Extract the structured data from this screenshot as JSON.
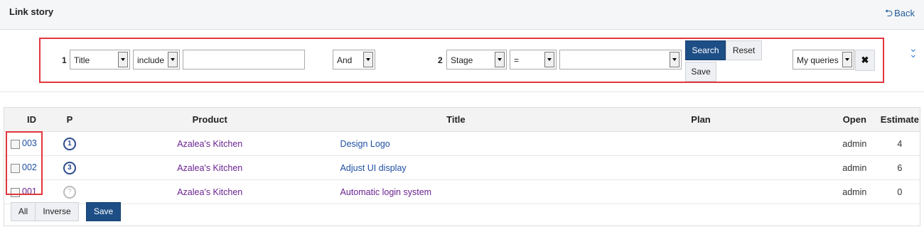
{
  "header": {
    "title": "Link story",
    "back_label": "Back"
  },
  "search": {
    "group1": {
      "index": "1",
      "field": "Title",
      "operator": "include",
      "value": ""
    },
    "logic": "And",
    "group2": {
      "index": "2",
      "field": "Stage",
      "operator": "=",
      "value": ""
    },
    "search_label": "Search",
    "reset_label": "Reset",
    "save_label": "Save",
    "queries_label": "My queries",
    "remove_icon": "✖"
  },
  "table": {
    "headers": [
      "ID",
      "P",
      "Product",
      "Title",
      "Plan",
      "Open",
      "Estimate"
    ],
    "rows": [
      {
        "id": "003",
        "priority": "1",
        "product": "Azalea's Kitchen",
        "title": "Design Logo",
        "plan": "",
        "open": "admin",
        "estimate": "4"
      },
      {
        "id": "002",
        "priority": "3",
        "product": "Azalea's Kitchen",
        "title": "Adjust UI display",
        "plan": "",
        "open": "admin",
        "estimate": "6"
      },
      {
        "id": "001",
        "priority": "?",
        "product": "Azalea's Kitchen",
        "title": "Automatic login system",
        "plan": "",
        "open": "admin",
        "estimate": "0"
      }
    ]
  },
  "footer": {
    "all_label": "All",
    "inverse_label": "Inverse",
    "save_label": "Save"
  }
}
